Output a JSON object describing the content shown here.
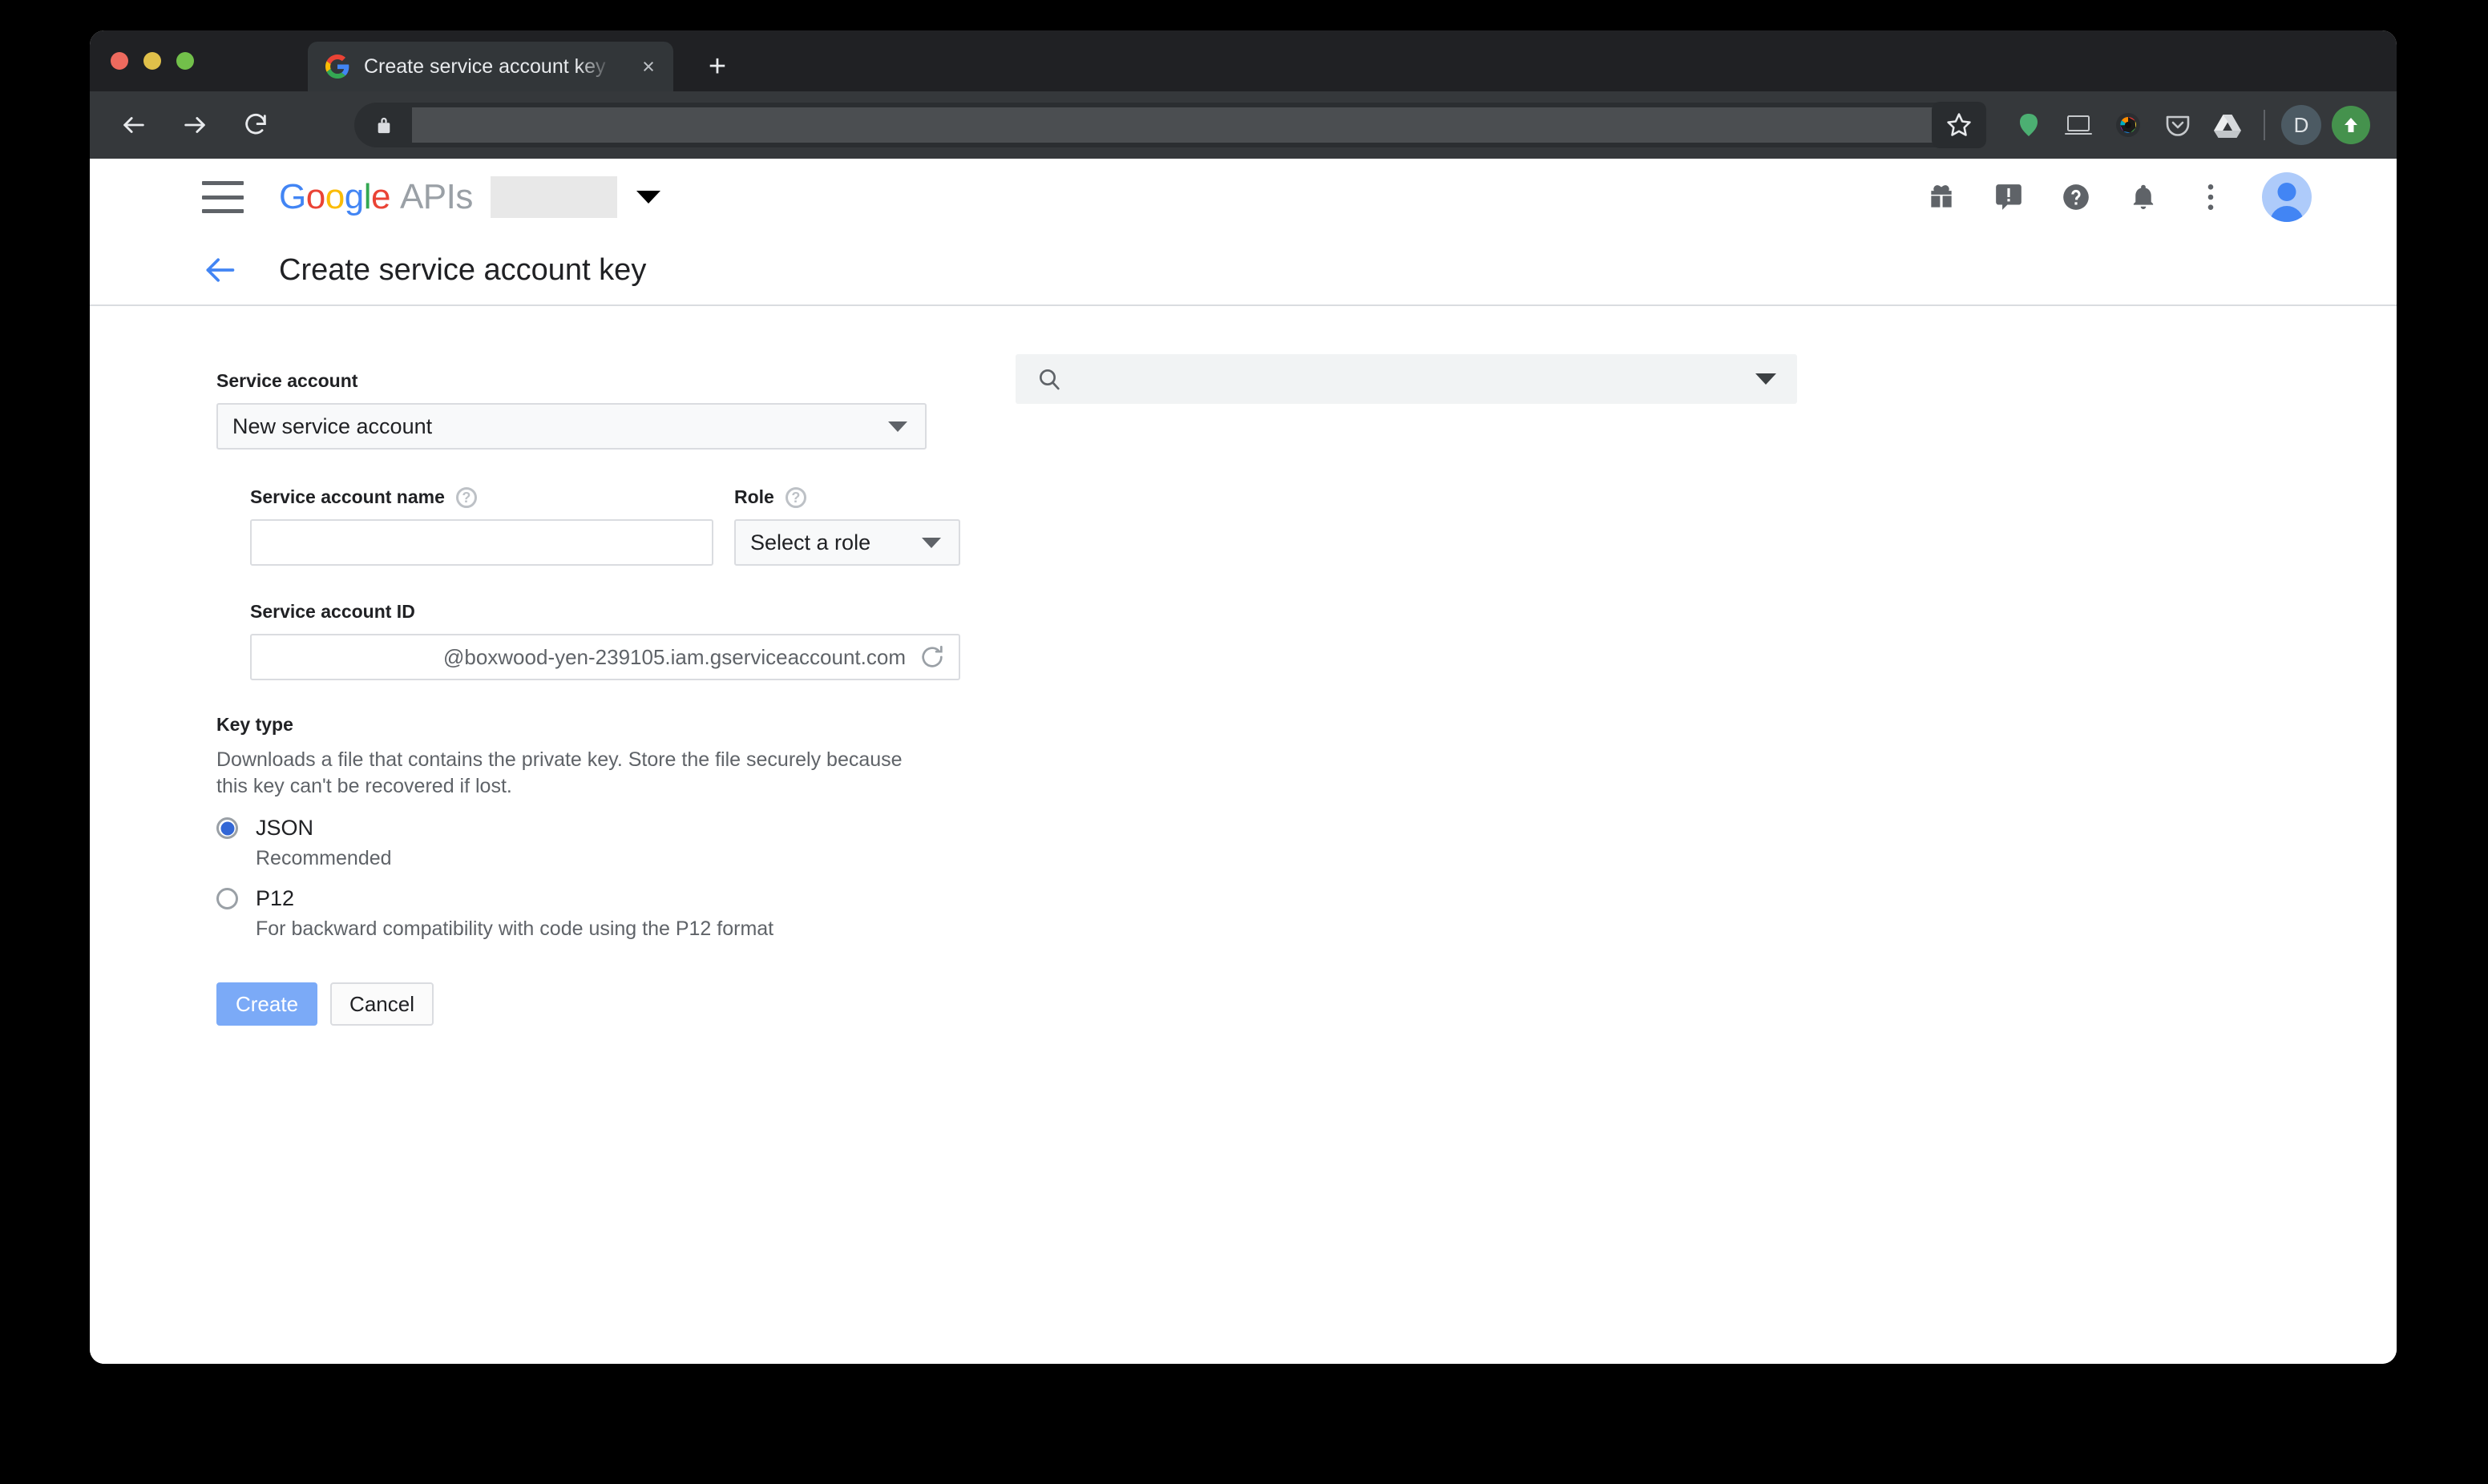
{
  "browser": {
    "tab": {
      "title": "Create service account key - M",
      "favicon": "google-favicon",
      "close_label": "×"
    },
    "new_tab_label": "+",
    "nav": {
      "back_label": "←",
      "forward_label": "→",
      "reload_label": "↻"
    },
    "omnibox": {
      "lock_icon": "lock-icon",
      "url_value": "",
      "url_redacted": true
    },
    "toolbar_icons": [
      {
        "name": "bookmark-star-icon",
        "label": "☆"
      },
      {
        "name": "evernote-extension-icon",
        "label": ""
      },
      {
        "name": "cast-screen-icon",
        "label": ""
      },
      {
        "name": "colorzilla-extension-icon",
        "label": ""
      },
      {
        "name": "pocket-extension-icon",
        "label": ""
      },
      {
        "name": "google-drive-extension-icon",
        "label": ""
      },
      {
        "name": "profile-avatar-icon",
        "label": "D"
      },
      {
        "name": "upload-extension-icon",
        "label": "⬆"
      }
    ]
  },
  "gapi_header": {
    "menu_icon": "hamburger-menu-icon",
    "logo": {
      "google": [
        "G",
        "o",
        "o",
        "g",
        "l",
        "e"
      ],
      "apis": "APIs"
    },
    "project_selector": {
      "value": "",
      "redacted": true
    },
    "search": {
      "value": "",
      "placeholder": "",
      "icon": "search-icon"
    },
    "actions": [
      {
        "name": "gift-icon",
        "label": "gift"
      },
      {
        "name": "feedback-icon",
        "label": "feedback"
      },
      {
        "name": "help-icon",
        "label": "help"
      },
      {
        "name": "notifications-bell-icon",
        "label": "notifications"
      },
      {
        "name": "more-vert-icon",
        "label": "more"
      }
    ],
    "avatar": {
      "name": "account-avatar"
    }
  },
  "page": {
    "back_arrow": "arrow-back-icon",
    "title": "Create service account key"
  },
  "form": {
    "service_account": {
      "label": "Service account",
      "selected": "New service account"
    },
    "service_account_name": {
      "label": "Service account name",
      "value": "",
      "placeholder": "",
      "has_help": true
    },
    "role": {
      "label": "Role",
      "selected": "Select a role",
      "has_help": true
    },
    "service_account_id": {
      "label": "Service account ID",
      "value": "",
      "suffix": "@boxwood-yen-239105.iam.gserviceaccount.com",
      "refresh_icon": "refresh-icon"
    },
    "key_type": {
      "label": "Key type",
      "description": "Downloads a file that contains the private key. Store the file securely because this key can't be recovered if lost.",
      "options": [
        {
          "label": "JSON",
          "sub": "Recommended",
          "selected": true
        },
        {
          "label": "P12",
          "sub": "For backward compatibility with code using the P12 format",
          "selected": false
        }
      ]
    },
    "buttons": {
      "create": "Create",
      "cancel": "Cancel"
    }
  },
  "colors": {
    "google_blue": "#4285f4",
    "google_red": "#ea4335",
    "google_yellow": "#fbbc05",
    "google_green": "#34a853",
    "create_button": "#7baaf7",
    "radio_selected": "#3367d6",
    "text_primary": "#202124",
    "text_secondary": "#5f6368"
  }
}
